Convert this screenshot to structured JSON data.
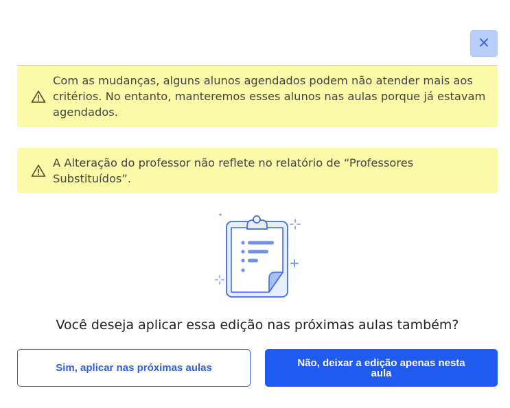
{
  "dialog": {
    "alerts": [
      {
        "text": "Com as mudanças, alguns alunos agendados podem não atender mais aos critérios. No entanto, manteremos esses alunos nas aulas porque já estavam agendados."
      },
      {
        "text": "A Alteração do professor não reflete no relatório de “Professores Substituídos”."
      }
    ],
    "question": "Você deseja aplicar essa edição nas próximas aulas também?",
    "yes_label": "Sim, aplicar nas próximas aulas",
    "no_label": "Não, deixar a edição apenas nesta aula",
    "icons": {
      "close": "close-icon",
      "warning": "warning-icon",
      "illustration": "clipboard-illustration"
    },
    "colors": {
      "primary": "#1f5bf0",
      "alert_bg": "#fafaa8",
      "close_bg": "#b8cdfa"
    }
  }
}
